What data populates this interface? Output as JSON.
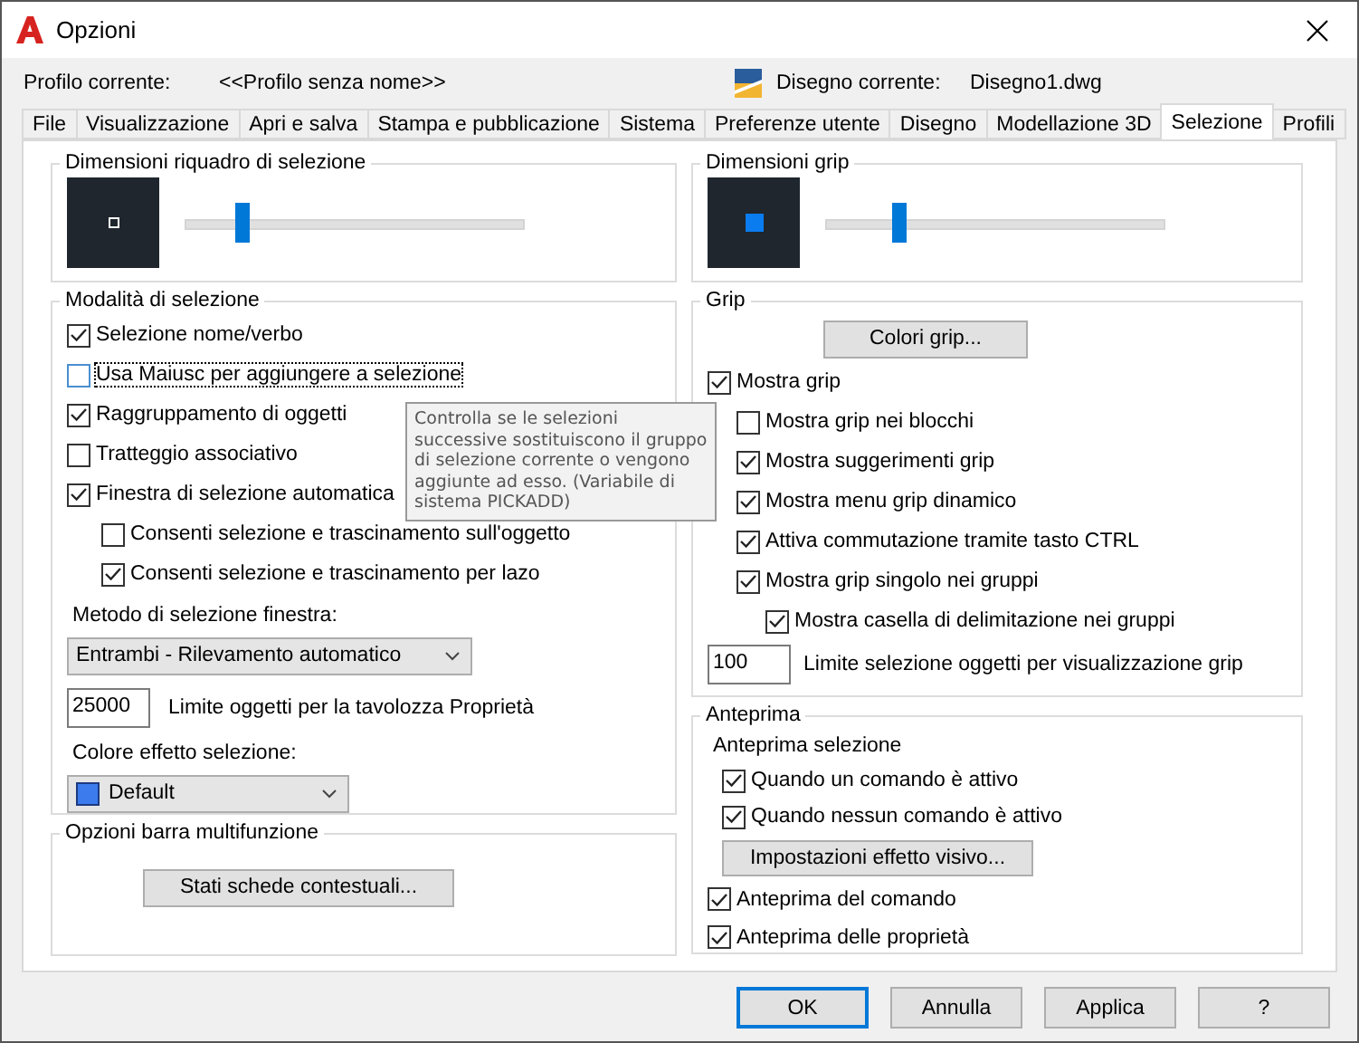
{
  "window": {
    "title": "Opzioni"
  },
  "profile": {
    "label": "Profilo corrente:",
    "value": "<<Profilo senza nome>>"
  },
  "drawing": {
    "label": "Disegno corrente:",
    "value": "Disegno1.dwg"
  },
  "tabs": [
    {
      "label": "File",
      "selected": false
    },
    {
      "label": "Visualizzazione",
      "selected": false
    },
    {
      "label": "Apri e salva",
      "selected": false
    },
    {
      "label": "Stampa e pubblicazione",
      "selected": false
    },
    {
      "label": "Sistema",
      "selected": false
    },
    {
      "label": "Preferenze utente",
      "selected": false
    },
    {
      "label": "Disegno",
      "selected": false
    },
    {
      "label": "Modellazione 3D",
      "selected": false
    },
    {
      "label": "Selezione",
      "selected": true
    },
    {
      "label": "Profili",
      "selected": false
    }
  ],
  "pickbox": {
    "title": "Dimensioni riquadro di selezione",
    "level": 0.17
  },
  "selection_modes": {
    "title": "Modalità di selezione",
    "options": [
      {
        "label": "Selezione nome/verbo",
        "checked": true,
        "focused": false
      },
      {
        "label": "Usa Maiusc per aggiungere a selezione",
        "checked": false,
        "focused": true
      },
      {
        "label": "Raggruppamento di oggetti",
        "checked": true,
        "focused": false
      },
      {
        "label": "Tratteggio associativo",
        "checked": false,
        "focused": false
      },
      {
        "label": "Finestra di selezione automatica",
        "checked": true,
        "focused": false,
        "children": [
          {
            "label": "Consenti selezione e trascinamento sull'oggetto",
            "checked": false,
            "focused": false
          },
          {
            "label": "Consenti selezione e trascinamento per lazo",
            "checked": true,
            "focused": false
          }
        ]
      }
    ],
    "window_method": {
      "label": "Metodo di selezione finestra:",
      "value": "Entrambi - Rilevamento automatico"
    },
    "properties_limit": {
      "value": "25000",
      "label": "Limite oggetti per la tavolozza Proprietà"
    },
    "effect_color": {
      "label": "Colore effetto selezione:",
      "value": "Default"
    }
  },
  "ribbon": {
    "title": "Opzioni barra multifunzione",
    "button": "Stati schede contestuali..."
  },
  "grip_size": {
    "title": "Dimensioni grip",
    "level": 0.22
  },
  "grips": {
    "title": "Grip",
    "colors_button": "Colori grip...",
    "options": [
      {
        "label": "Mostra grip",
        "checked": true,
        "children": [
          {
            "label": "Mostra grip nei blocchi",
            "checked": false
          },
          {
            "label": "Mostra suggerimenti grip",
            "checked": true
          },
          {
            "label": "Mostra menu grip dinamico",
            "checked": true
          },
          {
            "label": "Attiva commutazione tramite tasto CTRL",
            "checked": true
          },
          {
            "label": "Mostra grip singolo nei gruppi",
            "checked": true,
            "children": [
              {
                "label": "Mostra casella di delimitazione nei gruppi",
                "checked": true
              }
            ]
          }
        ]
      }
    ],
    "limit": {
      "value": "100",
      "label": "Limite selezione oggetti per visualizzazione grip"
    }
  },
  "preview": {
    "title": "Anteprima",
    "subtitle": "Anteprima selezione",
    "sub_options": [
      {
        "label": "Quando un comando è attivo",
        "checked": true
      },
      {
        "label": "Quando nessun comando è attivo",
        "checked": true
      }
    ],
    "effect_button": "Impostazioni effetto visivo...",
    "options": [
      {
        "label": "Anteprima del comando",
        "checked": true
      },
      {
        "label": "Anteprima delle proprietà",
        "checked": true
      }
    ]
  },
  "tooltip": {
    "text": "Controlla se le selezioni successive sostituiscono il gruppo di selezione corrente o vengono aggiunte ad esso. (Variabile di sistema PICKADD)"
  },
  "buttons": [
    {
      "label": "OK",
      "default": true
    },
    {
      "label": "Annulla",
      "default": false
    },
    {
      "label": "Applica",
      "default": false
    },
    {
      "label": "?",
      "default": false
    }
  ]
}
